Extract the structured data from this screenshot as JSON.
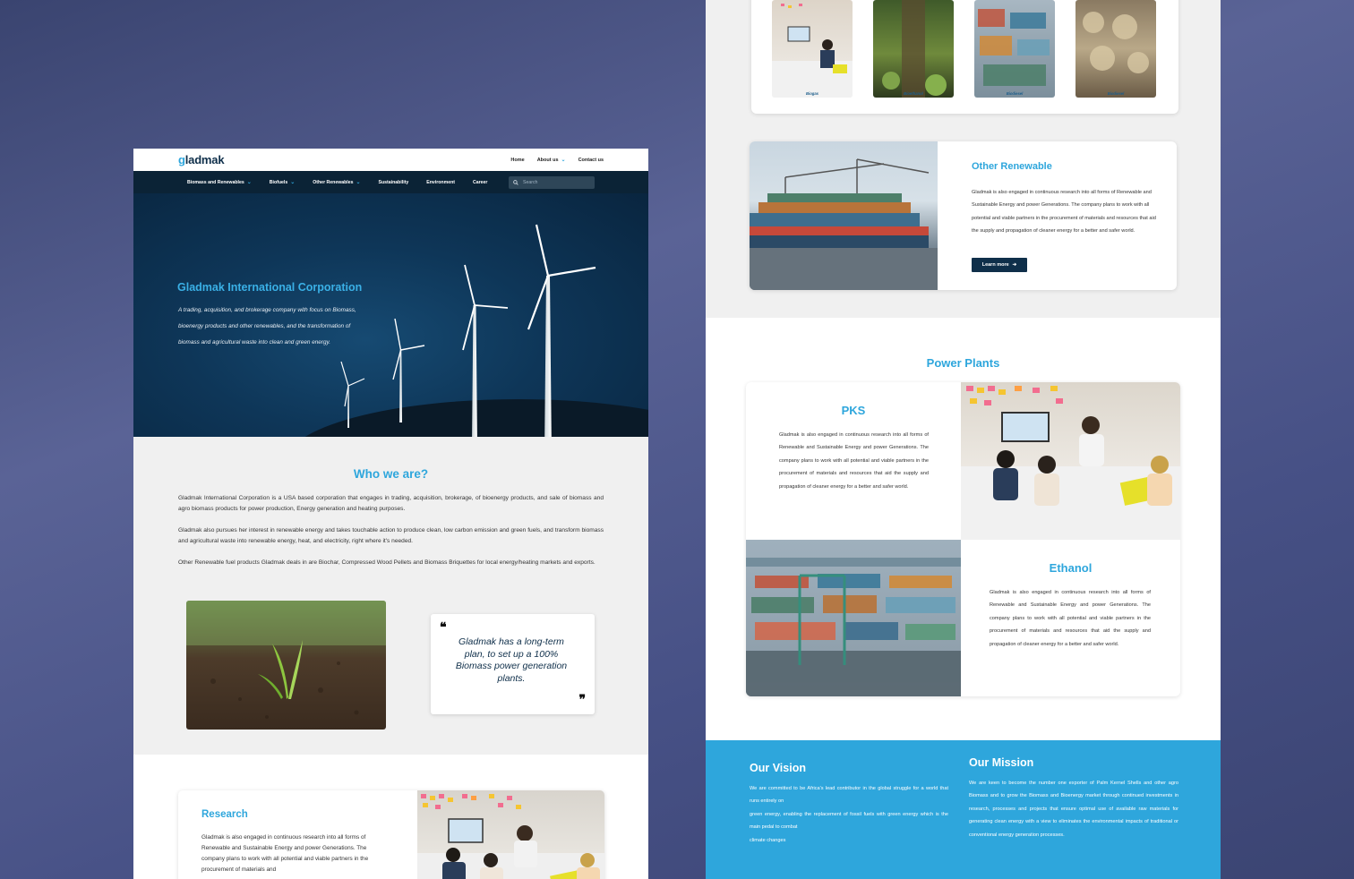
{
  "left_page": {
    "logo": {
      "g": "g",
      "rest": "ladmak"
    },
    "topnav": {
      "home": "Home",
      "about": "About us",
      "contact": "Contact us"
    },
    "mainnav": {
      "items": [
        "Biomass and Renewables",
        "Biofuels",
        "Other Renewables",
        "Sustainability",
        "Environment",
        "Career"
      ],
      "search_placeholder": "Search"
    },
    "hero": {
      "title": "Gladmak International Corporation",
      "text": "A trading, acquisition, and brokerage company with focus on Biomass, bioenergy products and other renewables, and the transformation of biomass and agricultural waste into clean and green energy."
    },
    "who": {
      "title": "Who we are?",
      "p1": "Gladmak International Corporation is a USA based corporation that engages in trading, acquisition, brokerage, of bioenergy products, and sale of biomass and agro biomass products for power production, Energy generation and heating purposes.",
      "p2": "Gladmak also pursues her interest in renewable energy and takes touchable action to produce clean, low carbon emission and green fuels, and transform biomass and agricultural waste into renewable energy, heat, and electricity, right where it's needed.",
      "p3": "Other Renewable fuel products Gladmak deals in are Biochar, Compressed Wood Pellets and Biomass Briquettes for local energy/heating markets and exports.",
      "quote": "Gladmak has a long-term plan, to set up a 100% Biomass power generation plants.",
      "quote_open": "❝",
      "quote_close": "❞"
    },
    "research": {
      "title": "Research",
      "text": "Gladmak is also engaged in continuous research into all forms of Renewable and Sustainable Energy and power Generations. The company plans to work with all potential and viable partners in the procurement of materials and"
    }
  },
  "right_page": {
    "thumbs": [
      "Biogas",
      "Bioethanol",
      "Biodiesel",
      "Biodiesel"
    ],
    "other": {
      "title": "Other Renewable",
      "text": "Gladmak is also engaged in continuous research into all forms of Renewable and Sustainable Energy and power Generations. The company plans to work with all potential and viable partners in the procurement of materials and resources that aid the supply and propagation of cleaner energy for a better and safer world.",
      "button": "Learn more",
      "button_arrow": "➔"
    },
    "plants": {
      "title": "Power Plants",
      "pks_title": "PKS",
      "pks_text": "Gladmak is also engaged in continuous research into all forms of Renewable and Sustainable Energy and power Generations. The company plans to work with all potential and viable partners in the procurement of materials and resources that aid the supply and propagation of cleaner energy for a better and safer world.",
      "ethanol_title": "Ethanol",
      "ethanol_text": "Gladmak is also engaged in continuous research into all forms of Renewable and Sustainable Energy and power Generations. The company plans to work with all potential and viable partners in the procurement of materials and resources that aid the supply and propagation of cleaner energy for a better and safer world."
    },
    "vision": {
      "title": "Our Vision",
      "l1": "We are committed to be Africa's lead contributor in the global struggle for a world that runs entirely on",
      "l2": "green energy, enabling the replacement of fossil fuels with green energy which is the main pedal to combat",
      "l3": "climate changes"
    },
    "mission": {
      "title": "Our Mission",
      "text": "We are keen to become the number one exporter of Palm Kernel Shells and other agro Biomass and to grow the Biomass and Bioenergy market through continued investments in research, processes and projects that ensure optimal use of available raw materials for generating clean energy with a view to eliminates the environmental impacts of traditional or conventional energy generation processes."
    }
  },
  "colors": {
    "accent": "#2ea6dc",
    "navy": "#0f2f4a",
    "nav_bg": "#0b2336",
    "backdrop": "#4f5a8c"
  }
}
